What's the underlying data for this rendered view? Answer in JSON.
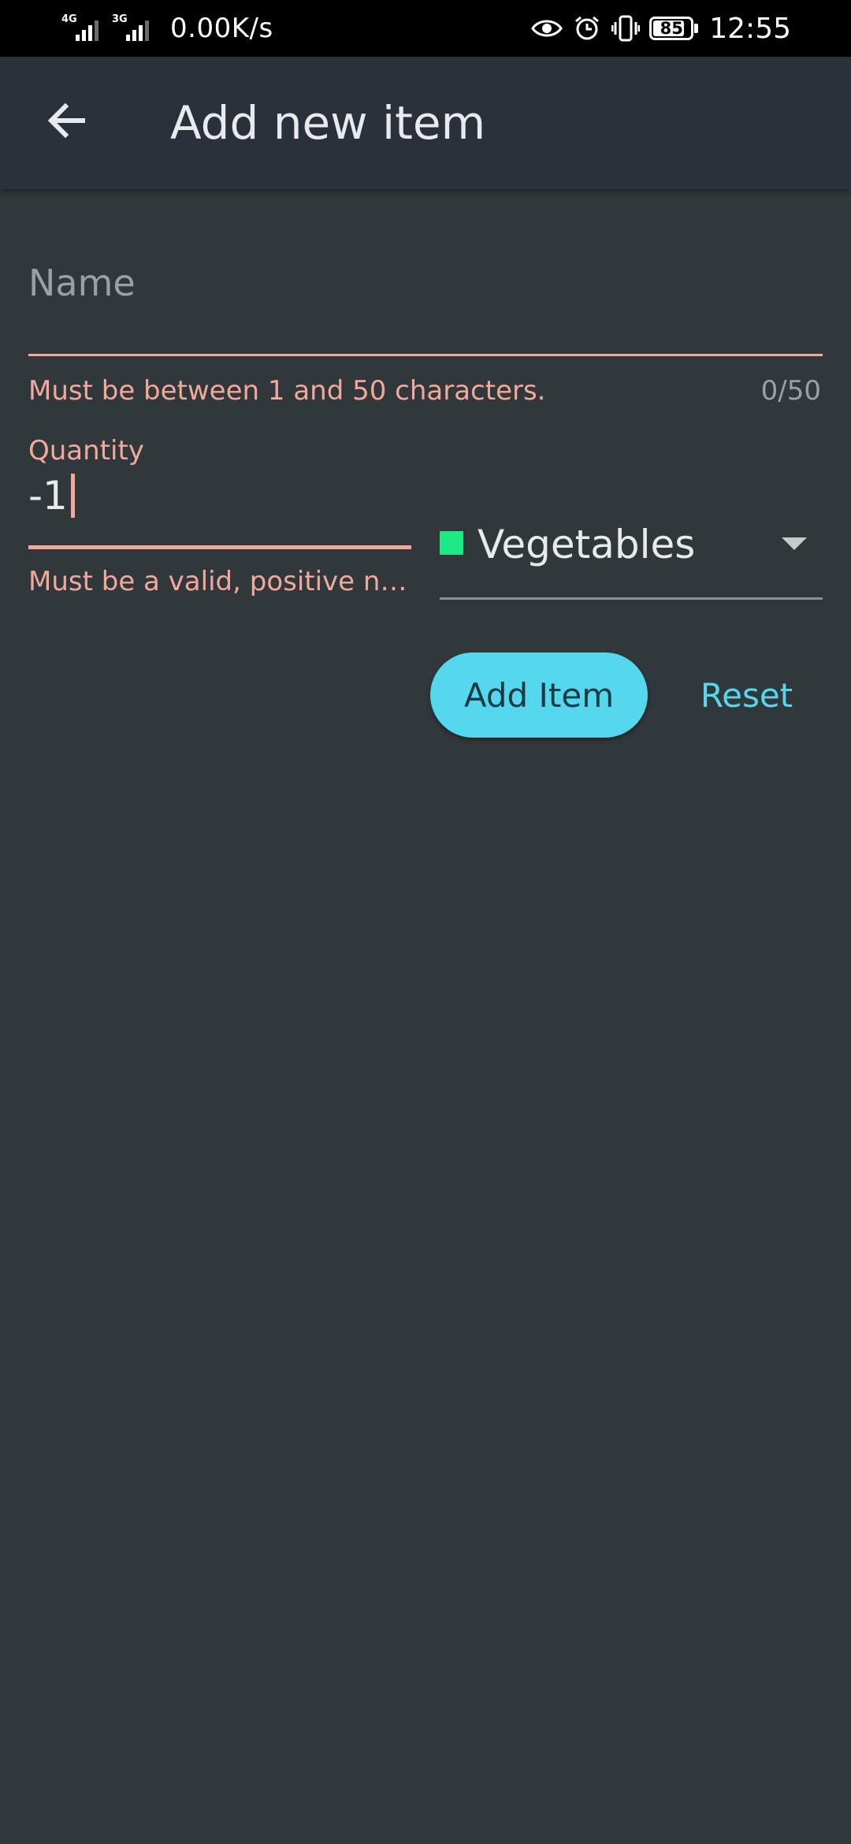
{
  "status_bar": {
    "network_1": "4G",
    "network_2": "3G",
    "speed": "0.00K/s",
    "battery": "85",
    "battery_level": 0.85,
    "time": "12:55",
    "icons": [
      "eye-icon",
      "alarm-icon",
      "vibrate-icon"
    ]
  },
  "app_bar": {
    "back_icon": "arrow-back-icon",
    "title": "Add new item"
  },
  "form": {
    "name": {
      "placeholder": "Name",
      "value": "",
      "error": "Must be between 1 and 50 characters.",
      "counter": "0/50"
    },
    "quantity": {
      "label": "Quantity",
      "value": "-1",
      "error": "Must be a valid, positive number."
    },
    "category": {
      "selected": "Vegetables",
      "swatch_color": "#1de985"
    },
    "add_button_label": "Add Item",
    "reset_button_label": "Reset"
  },
  "colors": {
    "background": "#31383b",
    "app_bar": "#2a313b",
    "error": "#f2a89b",
    "accent": "#55d8ee"
  }
}
